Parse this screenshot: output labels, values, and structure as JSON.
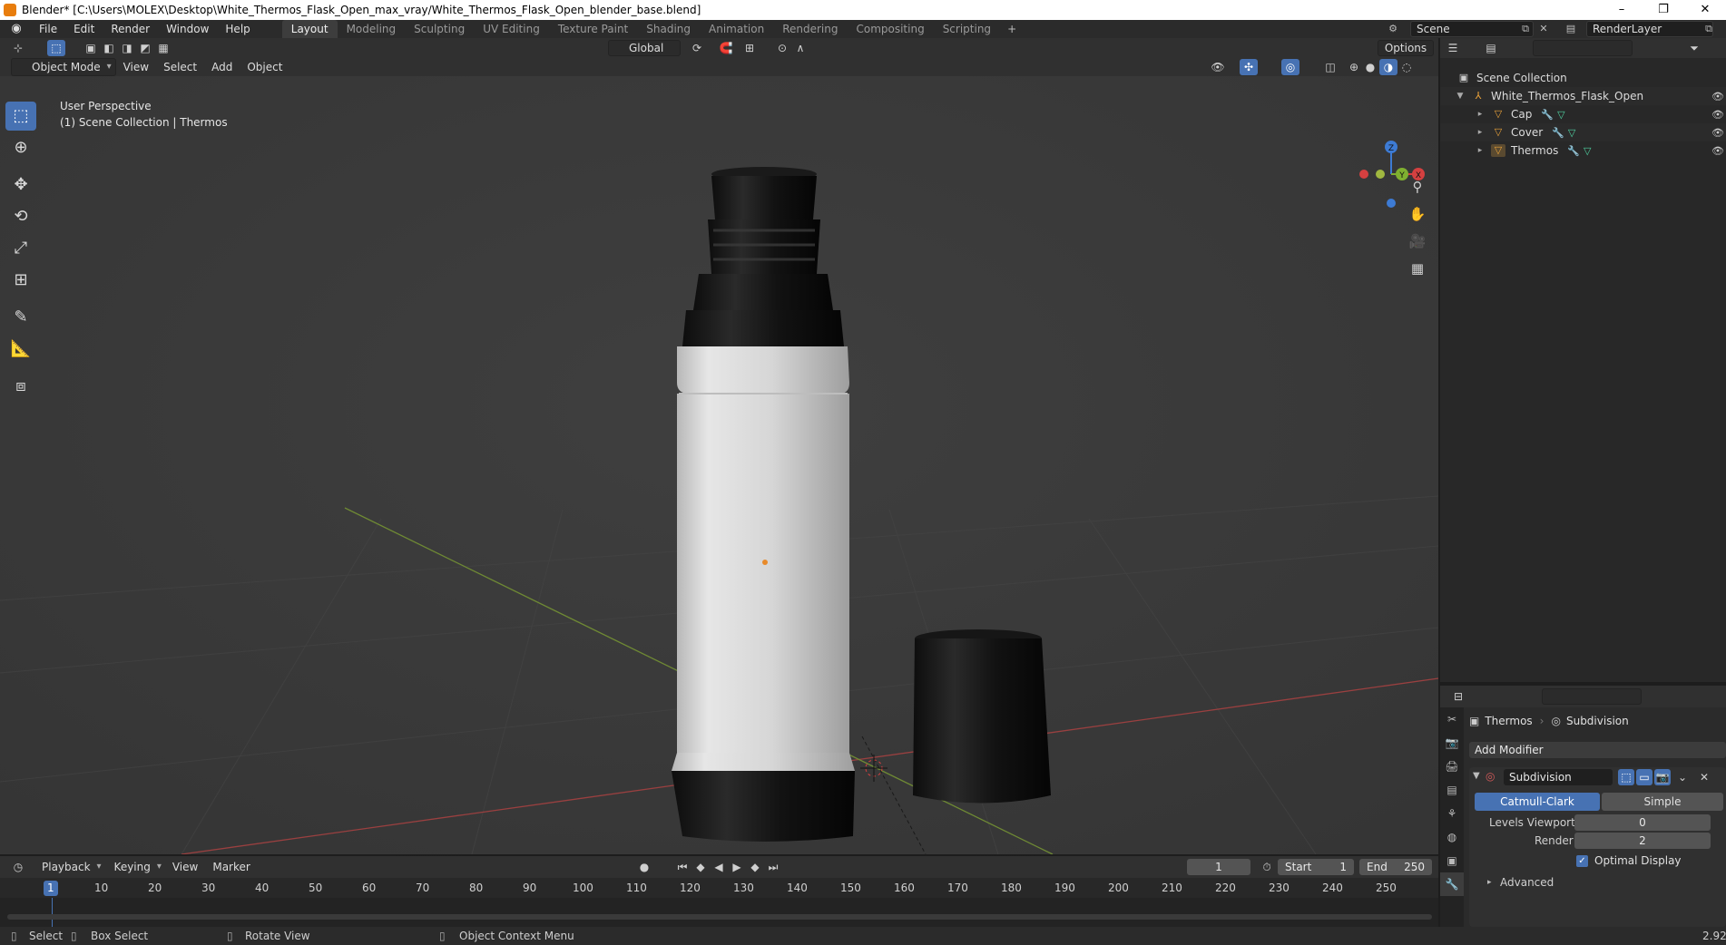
{
  "window": {
    "title": "Blender* [C:\\Users\\MOLEX\\Desktop\\White_Thermos_Flask_Open_max_vray/White_Thermos_Flask_Open_blender_base.blend]",
    "controls": [
      "–",
      "❐",
      "✕"
    ]
  },
  "menubar": {
    "items": [
      "File",
      "Edit",
      "Render",
      "Window",
      "Help"
    ],
    "workspaces": [
      "Layout",
      "Modeling",
      "Sculpting",
      "UV Editing",
      "Texture Paint",
      "Shading",
      "Animation",
      "Rendering",
      "Compositing",
      "Scripting"
    ],
    "active_workspace": "Layout",
    "add_tab": "+",
    "scene": "Scene",
    "render_layer": "RenderLayer"
  },
  "viewport": {
    "mode": "Object Mode",
    "menus": [
      "View",
      "Select",
      "Add",
      "Object"
    ],
    "transform_orientation": "Global",
    "options_label": "Options",
    "perspective_label": "User Perspective",
    "collection_label": "(1) Scene Collection | Thermos",
    "tools": [
      "select-box",
      "cursor",
      "move",
      "rotate",
      "scale",
      "transform",
      "annotate",
      "measure",
      "add-cube"
    ],
    "gizmo": {
      "z": "Z",
      "y": "Y",
      "x": "X"
    },
    "colors": {
      "background": "#3b3b3b",
      "grid": "#454545",
      "x_axis": "#b04a4a",
      "y_axis": "#7a9a3a",
      "thermos_body": "#dcdcdc",
      "thermos_dark": "#111111"
    }
  },
  "outliner": {
    "root": "Scene Collection",
    "collection": "White_Thermos_Flask_Open",
    "objects": [
      "Cap",
      "Cover",
      "Thermos"
    ]
  },
  "properties": {
    "breadcrumb_object": "Thermos",
    "breadcrumb_modifier": "Subdivision",
    "add_modifier": "Add Modifier",
    "modifier_name": "Subdivision",
    "mode_catmull": "Catmull-Clark",
    "mode_simple": "Simple",
    "levels_viewport_label": "Levels Viewport",
    "levels_viewport_value": "0",
    "render_label": "Render",
    "render_value": "2",
    "optimal_display_label": "Optimal Display",
    "optimal_display_checked": true,
    "advanced_label": "Advanced"
  },
  "timeline": {
    "menus": [
      "Playback",
      "Keying",
      "View",
      "Marker"
    ],
    "current_frame": "1",
    "start_label": "Start",
    "start_value": "1",
    "end_label": "End",
    "end_value": "250",
    "ruler_current": "1",
    "ticks": [
      "10",
      "20",
      "30",
      "40",
      "50",
      "60",
      "70",
      "80",
      "90",
      "100",
      "110",
      "120",
      "130",
      "140",
      "150",
      "160",
      "170",
      "180",
      "190",
      "200",
      "210",
      "220",
      "230",
      "240",
      "250"
    ]
  },
  "statusbar": {
    "select": "Select",
    "box_select": "Box Select",
    "rotate_view": "Rotate View",
    "context_menu": "Object Context Menu",
    "version": "2.92"
  }
}
